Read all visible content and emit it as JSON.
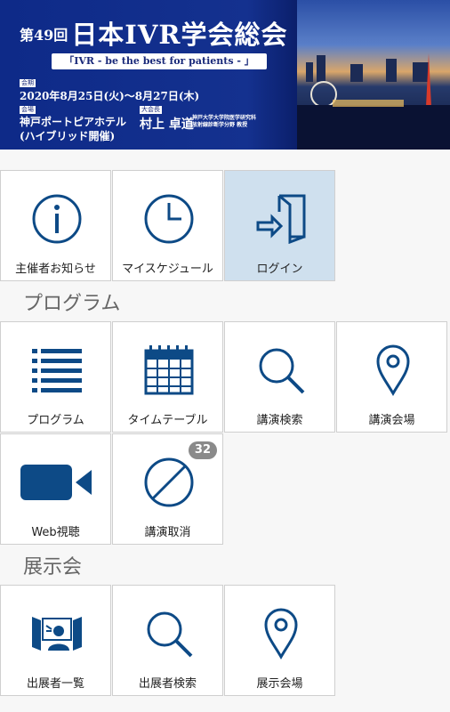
{
  "banner": {
    "session_number": "第49回",
    "title": "日本IVR学会総会",
    "theme": "「IVR - be the best for patients - 」",
    "period_tag": "会期",
    "dates": "2020年8月25日(火)～8月27日(木)",
    "venue_tag": "会場",
    "venue_line1": "神戸ポートピアホテル",
    "venue_line2": "(ハイブリッド開催)",
    "chair_tag": "大会長",
    "chair_name": "村上 卓道",
    "chair_affil_line1": "神戸大学大学院医学研究科",
    "chair_affil_line2": "放射線診断学分野 教授"
  },
  "top_tiles": [
    {
      "label": "主催者お知らせ",
      "icon": "info-icon"
    },
    {
      "label": "マイスケジュール",
      "icon": "clock-icon"
    },
    {
      "label": "ログイン",
      "icon": "login-icon"
    }
  ],
  "program_section": {
    "title": "プログラム",
    "tiles": [
      {
        "label": "プログラム",
        "icon": "list-icon"
      },
      {
        "label": "タイムテーブル",
        "icon": "calendar-icon"
      },
      {
        "label": "講演検索",
        "icon": "search-icon"
      },
      {
        "label": "講演会場",
        "icon": "map-pin-icon"
      },
      {
        "label": "Web視聴",
        "icon": "video-icon"
      },
      {
        "label": "講演取消",
        "icon": "cancel-icon",
        "badge": "32"
      }
    ]
  },
  "exhibition_section": {
    "title": "展示会",
    "tiles": [
      {
        "label": "出展者一覧",
        "icon": "exhibitor-icon"
      },
      {
        "label": "出展者検索",
        "icon": "search-icon"
      },
      {
        "label": "展示会場",
        "icon": "map-pin-icon"
      }
    ]
  },
  "colors": {
    "icon": "#0d4a86",
    "active_tile": "#cfe0ee",
    "badge": "#8a8a8a",
    "banner": "#14318f"
  }
}
